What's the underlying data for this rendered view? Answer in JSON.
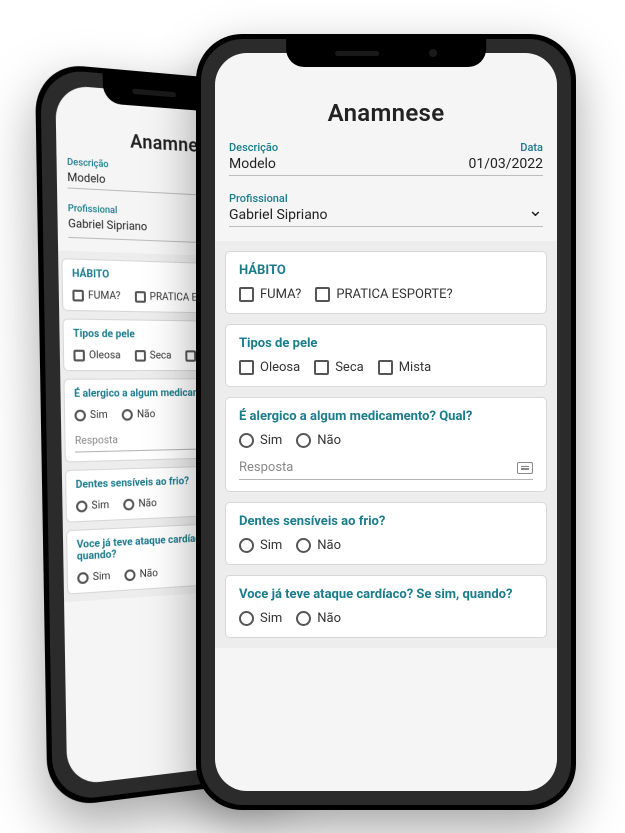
{
  "title": "Anamnese",
  "fields": {
    "descricao_label": "Descrição",
    "descricao_value": "Modelo",
    "data_label": "Data",
    "data_value": "01/03/2022",
    "profissional_label": "Profissional",
    "profissional_value": "Gabriel Sipriano"
  },
  "sections": {
    "habito": {
      "title": "HÁBITO",
      "fuma": "FUMA?",
      "esporte": "PRATICA ESPORTE?"
    },
    "pele": {
      "title": "Tipos de pele",
      "oleosa": "Oleosa",
      "seca": "Seca",
      "mista": "Mista"
    },
    "alergico": {
      "title": "É alergico a algum medicamento? Qual?",
      "sim": "Sim",
      "nao": "Não",
      "resposta_placeholder": "Resposta"
    },
    "dentes": {
      "title": "Dentes sensíveis ao frio?",
      "sim": "Sim",
      "nao": "Não"
    },
    "cardiaco": {
      "title": "Voce já teve ataque cardíaco? Se sim, quando?",
      "sim": "Sim",
      "nao": "Não"
    }
  }
}
